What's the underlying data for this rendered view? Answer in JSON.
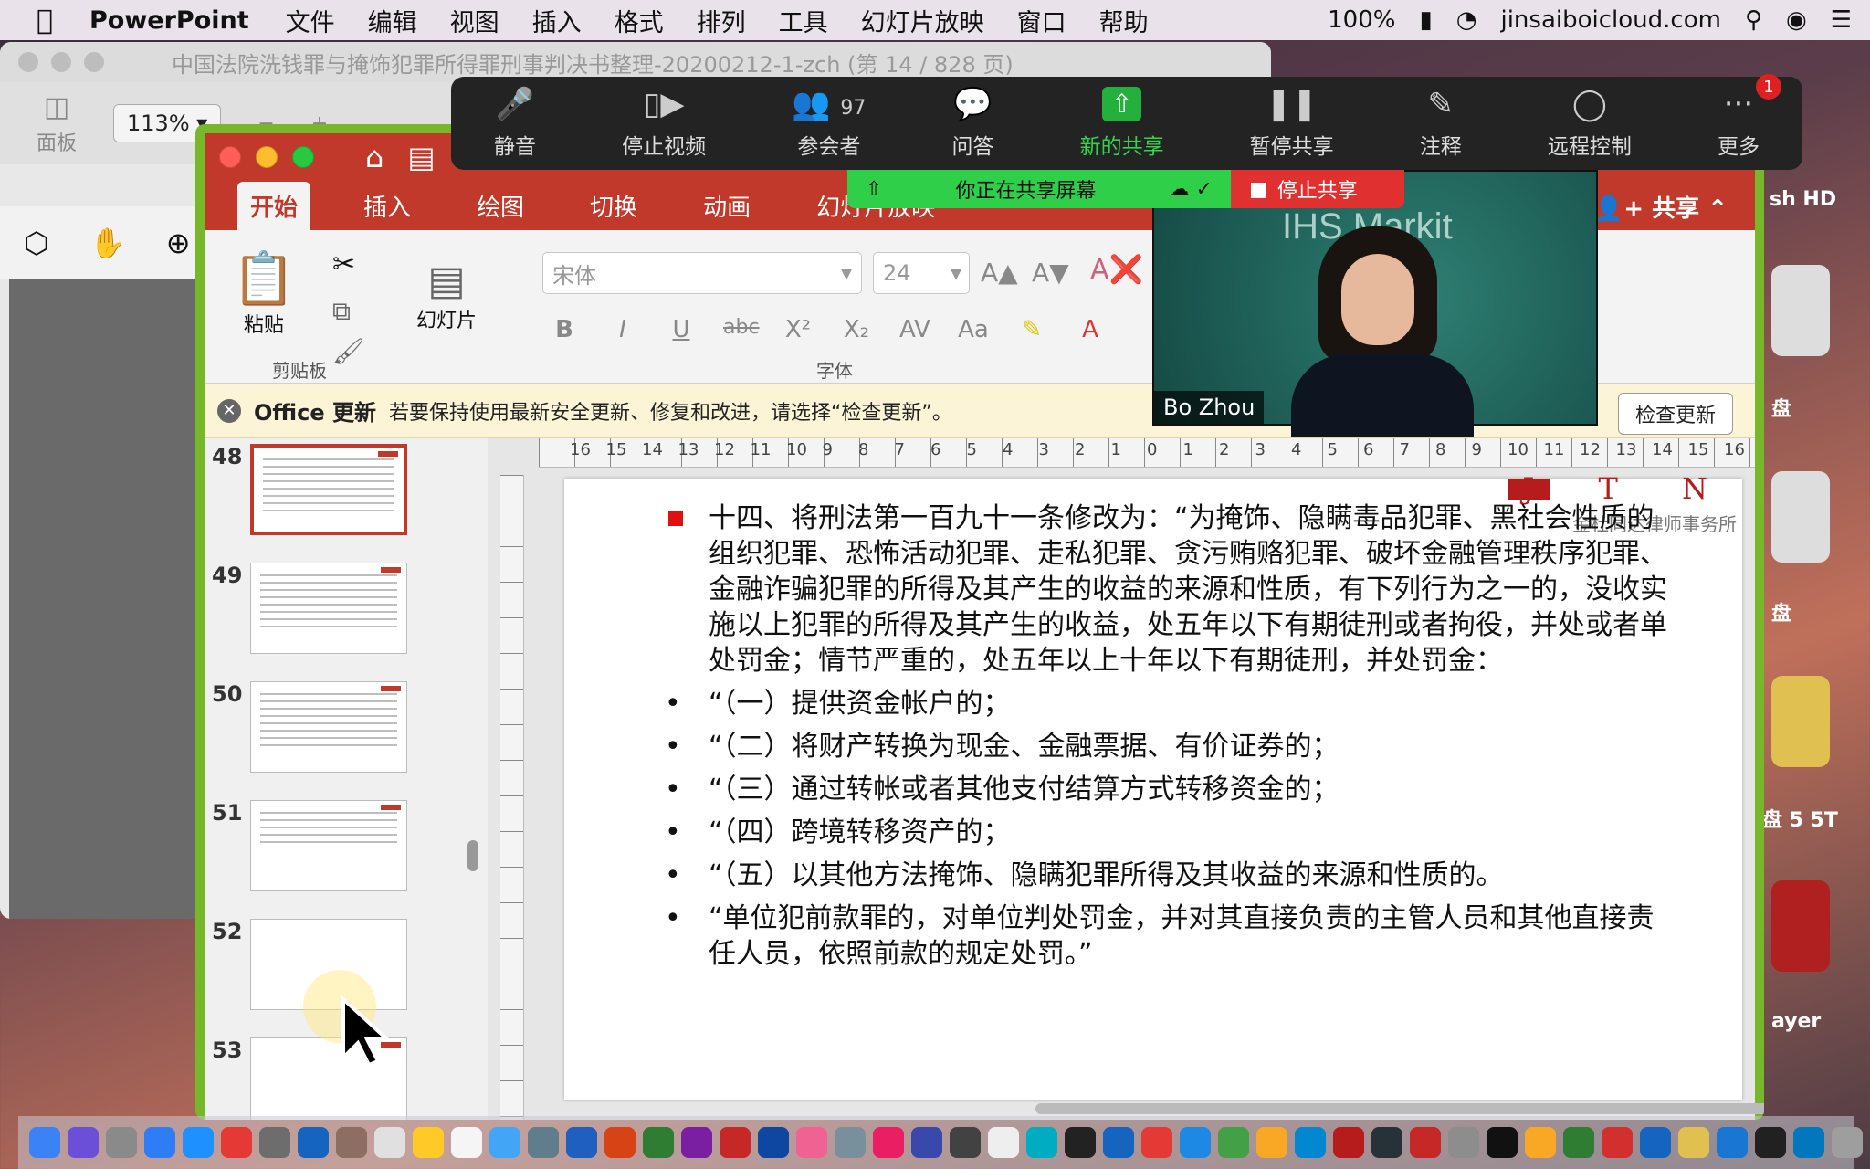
{
  "menubar": {
    "app_name": "PowerPoint",
    "items": [
      "文件",
      "编辑",
      "视图",
      "插入",
      "格式",
      "排列",
      "工具",
      "幻灯片放映",
      "窗口",
      "帮助"
    ],
    "battery": "100%",
    "account": "jinsaiboicloud.com"
  },
  "pdf_window": {
    "title": "中国法院洗钱罪与掩饰犯罪所得罪刑事判决书整理-20200212-1-zch (第 14 / 828 页)",
    "zoom": "113%",
    "sidebar_label": "面板"
  },
  "zoom_meeting": {
    "controls": [
      {
        "label": "静音",
        "icon": "microphone-icon"
      },
      {
        "label": "停止视频",
        "icon": "video-camera-icon"
      },
      {
        "label": "参会者",
        "icon": "participants-icon",
        "count": "97"
      },
      {
        "label": "问答",
        "icon": "qa-icon"
      },
      {
        "label": "新的共享",
        "icon": "share-screen-icon"
      },
      {
        "label": "暂停共享",
        "icon": "pause-icon"
      },
      {
        "label": "注释",
        "icon": "pencil-icon"
      },
      {
        "label": "远程控制",
        "icon": "mouse-icon"
      },
      {
        "label": "更多",
        "icon": "more-icon",
        "badge": "1"
      }
    ],
    "sharing_text": "你正在共享屏幕",
    "stop_share": "停止共享",
    "video_name": "Bo Zhou",
    "video_bg_text": "IHS Markit"
  },
  "ppt": {
    "tabs": [
      "开始",
      "插入",
      "绘图",
      "切换",
      "动画",
      "幻灯片放映"
    ],
    "active_tab": "开始",
    "share_label": "共享",
    "ribbon": {
      "paste": "粘贴",
      "clipboard_group": "剪贴板",
      "slides": "幻灯片",
      "font_group": "字体",
      "font_name": "宋体",
      "font_size": "24"
    },
    "update_bar": {
      "title": "Office 更新",
      "message": "若要保持使用最新安全更新、修复和改进，请选择“检查更新”。",
      "button": "检查更新"
    },
    "thumbnails": [
      "48",
      "49",
      "50",
      "51",
      "52",
      "53"
    ],
    "selected_slide": "48",
    "ruler_numbers": [
      "16",
      "15",
      "14",
      "13",
      "12",
      "11",
      "10",
      "9",
      "8",
      "7",
      "6",
      "5",
      "4",
      "3",
      "2",
      "1",
      "0",
      "1",
      "2",
      "3",
      "4",
      "5",
      "6",
      "7",
      "8",
      "9",
      "10",
      "11",
      "12",
      "13",
      "14",
      "15",
      "16"
    ],
    "slide": {
      "firm": "金杜同达律师事务所",
      "paragraphs": [
        "十四、将刑法第一百九十一条修改为：“为掩饰、隐瞒毒品犯罪、黑社会性质的组织犯罪、恐怖活动犯罪、走私犯罪、贪污贿赂犯罪、破坏金融管理秩序犯罪、金融诈骗犯罪的所得及其产生的收益的来源和性质，有下列行为之一的，没收实施以上犯罪的所得及其产生的收益，处五年以下有期徒刑或者拘役，并处或者单处罚金；情节严重的，处五年以上十年以下有期徒刑，并处罚金：",
        "“（一）提供资金帐户的；",
        "“（二）将财产转换为现金、金融票据、有价证券的；",
        "“（三）通过转帐或者其他支付结算方式转移资金的；",
        "“（四）跨境转移资产的；",
        "“（五）以其他方法掩饰、隐瞒犯罪所得及其收益的来源和性质的。",
        "“单位犯前款罪的，对单位判处罚金，并对其直接负责的主管人员和其他直接责任人员，依照前款的规定处罚。”"
      ]
    }
  },
  "desktop": {
    "labels": [
      "sh HD",
      "盘",
      "盘",
      "盘 5 5T",
      "ayer"
    ]
  }
}
